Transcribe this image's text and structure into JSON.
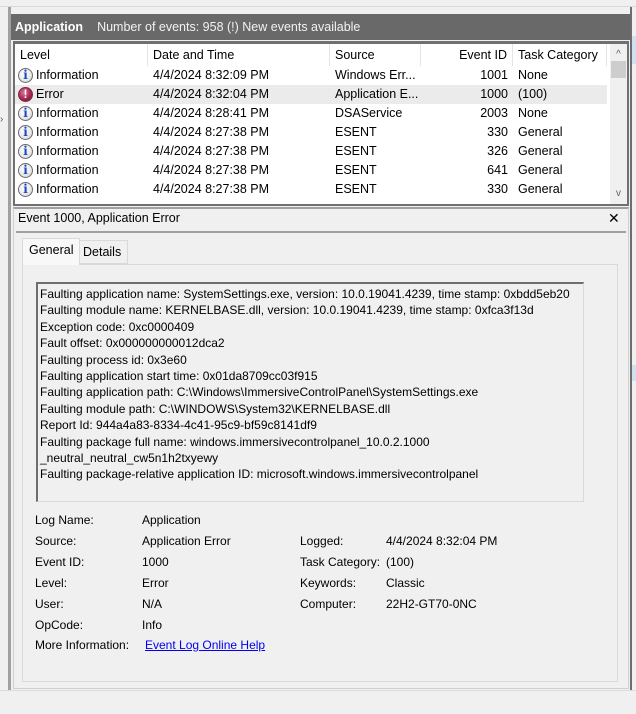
{
  "header": {
    "log_name": "Application",
    "event_info": "Number of events: 958 (!) New events available"
  },
  "events_table": {
    "columns": [
      "Level",
      "Date and Time",
      "Source",
      "Event ID",
      "Task Category"
    ],
    "rows": [
      {
        "icon": "information-icon",
        "level": "Information",
        "datetime": "4/4/2024 8:32:09 PM",
        "source": "Windows Err...",
        "event_id": "1001",
        "task_category": "None",
        "selected": false
      },
      {
        "icon": "error-icon",
        "level": "Error",
        "datetime": "4/4/2024 8:32:04 PM",
        "source": "Application E...",
        "event_id": "1000",
        "task_category": "(100)",
        "selected": true
      },
      {
        "icon": "information-icon",
        "level": "Information",
        "datetime": "4/4/2024 8:28:41 PM",
        "source": "DSAService",
        "event_id": "2003",
        "task_category": "None",
        "selected": false
      },
      {
        "icon": "information-icon",
        "level": "Information",
        "datetime": "4/4/2024 8:27:38 PM",
        "source": "ESENT",
        "event_id": "330",
        "task_category": "General",
        "selected": false
      },
      {
        "icon": "information-icon",
        "level": "Information",
        "datetime": "4/4/2024 8:27:38 PM",
        "source": "ESENT",
        "event_id": "326",
        "task_category": "General",
        "selected": false
      },
      {
        "icon": "information-icon",
        "level": "Information",
        "datetime": "4/4/2024 8:27:38 PM",
        "source": "ESENT",
        "event_id": "641",
        "task_category": "General",
        "selected": false
      },
      {
        "icon": "information-icon",
        "level": "Information",
        "datetime": "4/4/2024 8:27:38 PM",
        "source": "ESENT",
        "event_id": "330",
        "task_category": "General",
        "selected": false
      }
    ],
    "scroll_up_glyph": "^",
    "scroll_down_glyph": "v"
  },
  "detail": {
    "title": "Event 1000, Application Error",
    "close_glyph": "✕",
    "tabs": [
      {
        "label": "General",
        "active": true
      },
      {
        "label": "Details",
        "active": false
      }
    ],
    "description_lines": [
      "Faulting application name: SystemSettings.exe, version: 10.0.19041.4239, time stamp: 0xbdd5eb20",
      "Faulting module name: KERNELBASE.dll, version: 10.0.19041.4239, time stamp: 0xfca3f13d",
      "Exception code: 0xc0000409",
      "Fault offset: 0x000000000012dca2",
      "Faulting process id: 0x3e60",
      "Faulting application start time: 0x01da8709cc03f915",
      "Faulting application path: C:\\Windows\\ImmersiveControlPanel\\SystemSettings.exe",
      "Faulting module path: C:\\WINDOWS\\System32\\KERNELBASE.dll",
      "Report Id: 944a4a83-8334-4c41-95c9-bf59c8141df9",
      "Faulting package full name: windows.immersivecontrolpanel_10.0.2.1000",
      "_neutral_neutral_cw5n1h2txyewy",
      "Faulting package-relative application ID: microsoft.windows.immersivecontrolpanel"
    ],
    "fields_left": [
      {
        "label": "Log Name:",
        "value": "Application"
      },
      {
        "label": "Source:",
        "value": "Application Error"
      },
      {
        "label": "Event ID:",
        "value": "1000"
      },
      {
        "label": "Level:",
        "value": "Error"
      },
      {
        "label": "User:",
        "value": "N/A"
      },
      {
        "label": "OpCode:",
        "value": "Info"
      }
    ],
    "fields_right": [
      {
        "label": "Logged:",
        "value": "4/4/2024 8:32:04 PM"
      },
      {
        "label": "Task Category:",
        "value": "(100)"
      },
      {
        "label": "Keywords:",
        "value": "Classic"
      },
      {
        "label": "Computer:",
        "value": "22H2-GT70-0NC"
      }
    ],
    "more_info_label": "More Information:",
    "more_info_link": "Event Log Online Help"
  },
  "colors": {
    "header_bg": "#696969",
    "selected_row": "#ebebeb",
    "link": "#0000ee",
    "error_icon": "#a8264e",
    "info_icon_glyph": "#1b46c5"
  }
}
